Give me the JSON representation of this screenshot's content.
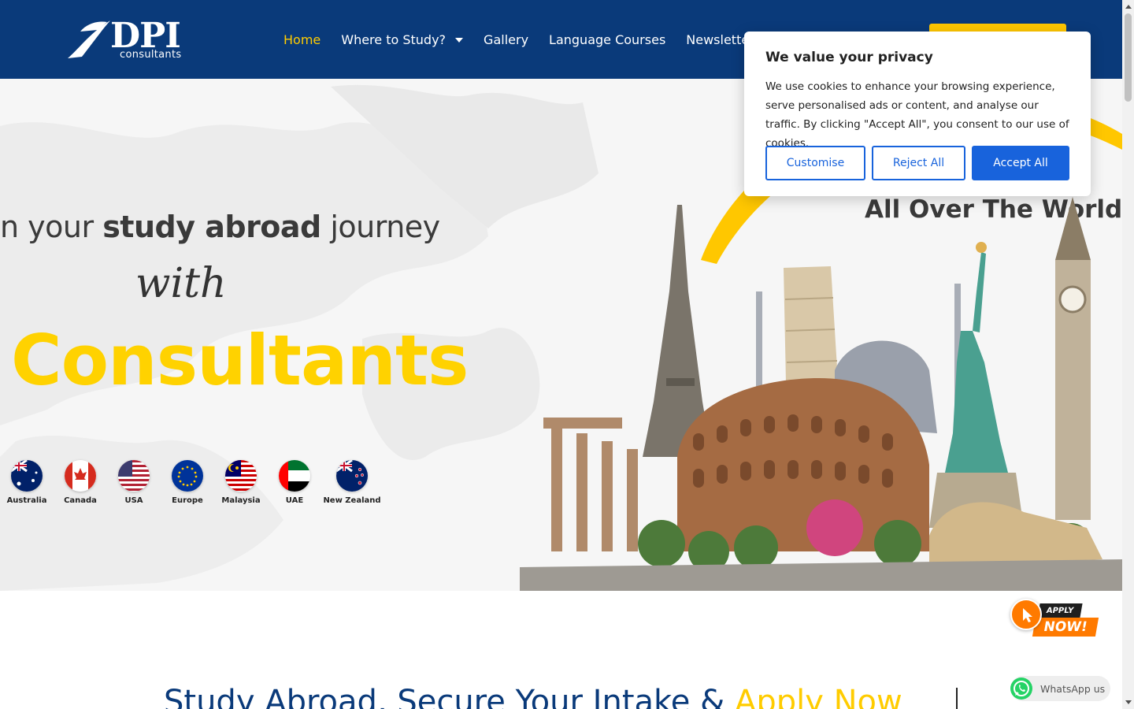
{
  "header": {
    "logo": {
      "main": "DPI",
      "sub": "consultants"
    },
    "nav": [
      {
        "label": "Home",
        "active": true
      },
      {
        "label": "Where to Study?",
        "dropdown": true
      },
      {
        "label": "Gallery"
      },
      {
        "label": "Language Courses"
      },
      {
        "label": "Newsletter"
      }
    ]
  },
  "hero": {
    "line1_pre": "n your ",
    "line1_bold": "study abroad",
    "line1_post": " journey",
    "with": "with",
    "brand_word": "Consultants",
    "right_heading": "All Over The World",
    "flags": [
      {
        "label": "Australia",
        "icon": "australia-flag-icon"
      },
      {
        "label": "Canada",
        "icon": "canada-flag-icon"
      },
      {
        "label": "USA",
        "icon": "usa-flag-icon"
      },
      {
        "label": "Europe",
        "icon": "europe-flag-icon"
      },
      {
        "label": "Malaysia",
        "icon": "malaysia-flag-icon"
      },
      {
        "label": "UAE",
        "icon": "uae-flag-icon"
      },
      {
        "label": "New Zealand",
        "icon": "new-zealand-flag-icon"
      }
    ]
  },
  "section": {
    "heading_main": "Study Abroad, Secure Your Intake & ",
    "heading_highlight": "Apply Now"
  },
  "cookie": {
    "title": "We value your privacy",
    "text": "We use cookies to enhance your browsing experience, serve personalised ads or content, and analyse our traffic. By clicking \"Accept All\", you consent to our use of cookies.",
    "customise": "Customise",
    "reject": "Reject All",
    "accept": "Accept All"
  },
  "apply_badge": {
    "top": "APPLY",
    "bottom": "NOW!"
  },
  "whatsapp": {
    "label": "WhatsApp us"
  },
  "colors": {
    "navy": "#0a3a7a",
    "yellow": "#ffd200",
    "cookie_blue": "#1863dc",
    "whatsapp_green": "#25d366",
    "orange": "#ff7a00"
  }
}
